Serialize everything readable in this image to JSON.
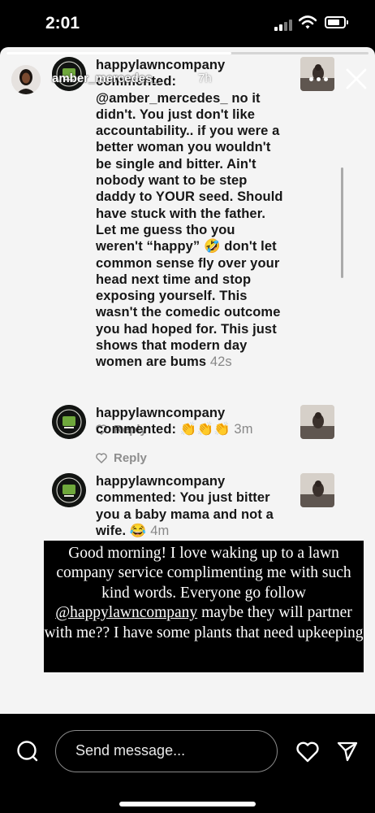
{
  "status_bar": {
    "time": "2:01"
  },
  "story": {
    "username": "amber_mercedes_",
    "time_ago": "7h",
    "progress": 0.62
  },
  "comments": [
    {
      "author": "happylawncompany",
      "verb": "commented:",
      "mention": "@amber_mercedes_",
      "text": "no it didn't. You just don't like accountability.. if you were a better woman you wouldn't be single and bitter. Ain't nobody want to be step daddy to YOUR seed. Should have stuck with the father. Let me guess tho you weren't “happy” 🤣 don't let common sense fly over your head next time and stop exposing yourself. This wasn't the comedic outcome you had hoped for. This just shows that modern day women are bums",
      "time": "42s",
      "reply_label": "Reply"
    },
    {
      "author": "happylawncompany",
      "verb": "commented:",
      "text": "👏👏👏",
      "time": "3m",
      "reply_label": "Reply"
    },
    {
      "author": "happylawncompany",
      "verb": "commented:",
      "text": "You just bitter you a baby mama and not a wife. 😂",
      "time": "4m"
    }
  ],
  "caption": {
    "before": "Good morning! I love waking up to a lawn company service complimenting me with such kind words. Everyone go follow",
    "handle": "@happylawncompany",
    "after": "maybe they will partner with me?? I have some plants that need upkeeping"
  },
  "bottom_bar": {
    "message_placeholder": "Send message..."
  },
  "colors": {
    "background": "#000000",
    "story_bg": "#f4f4f4",
    "text": "#161616",
    "muted": "#8d8d8d"
  },
  "icons": [
    "camera-icon",
    "heart-icon",
    "send-icon",
    "close-icon",
    "more-icon",
    "signal-icon",
    "wifi-icon",
    "battery-icon"
  ]
}
